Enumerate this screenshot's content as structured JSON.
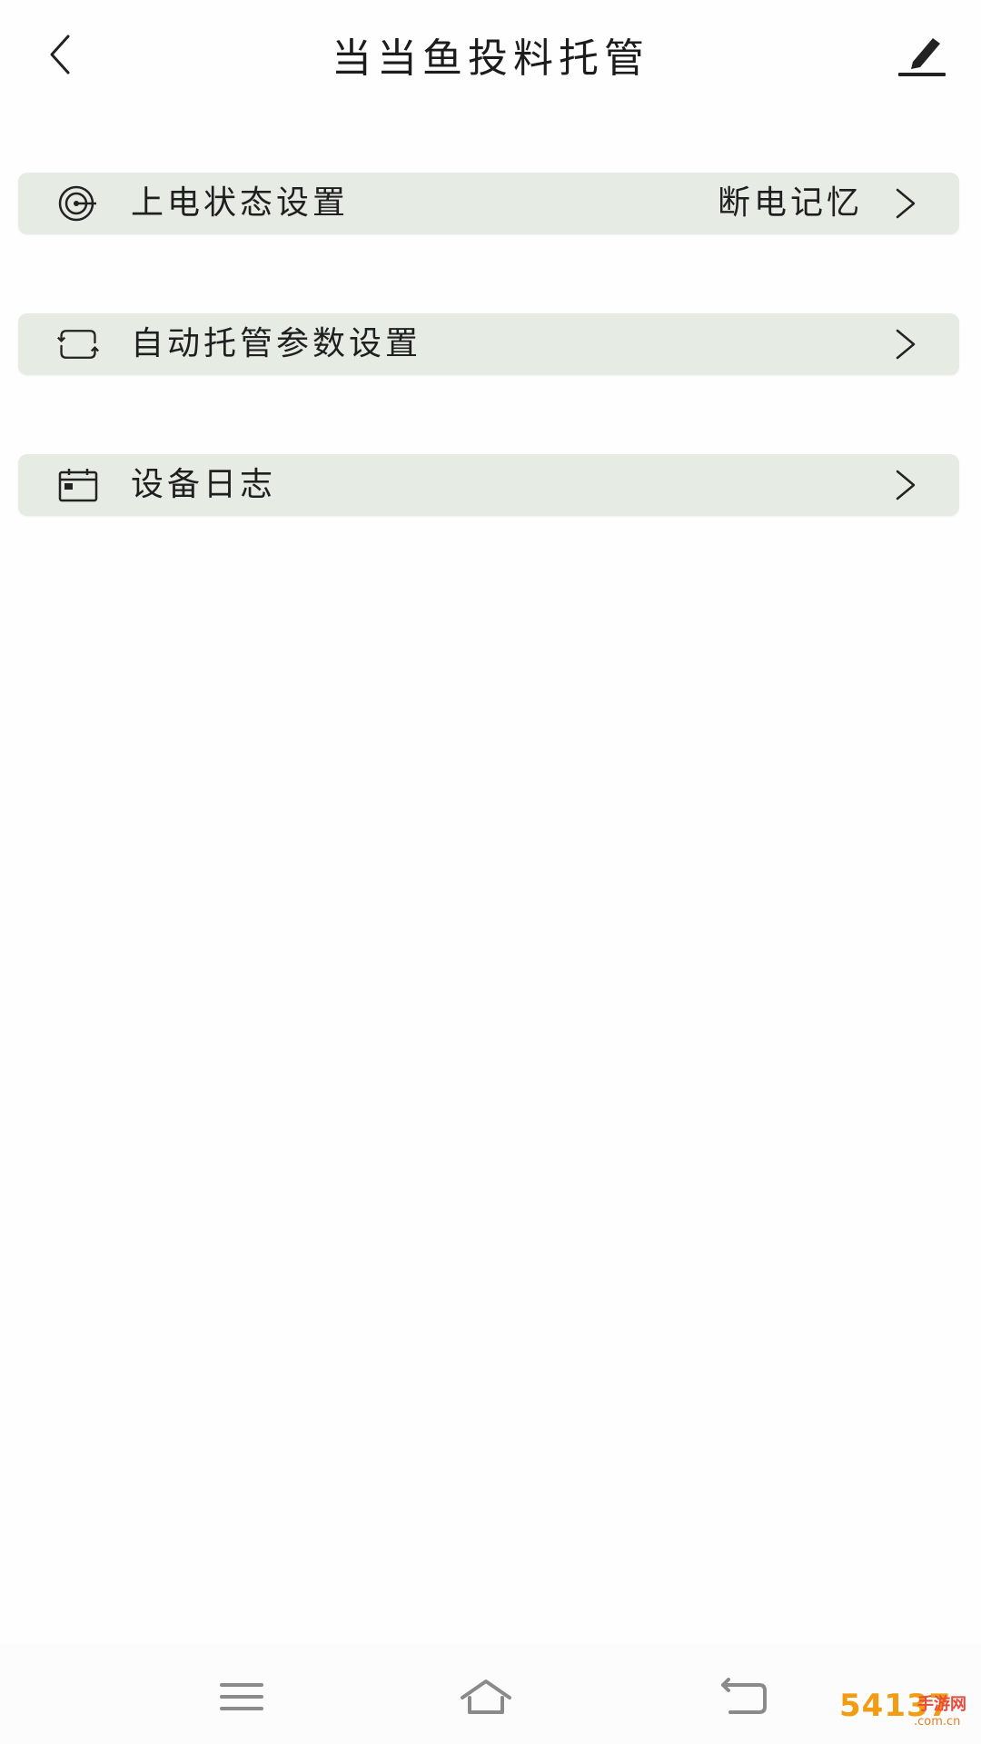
{
  "header": {
    "title": "当当鱼投料托管"
  },
  "rows": [
    {
      "label": "上电状态设置",
      "value": "断电记忆",
      "icon": "power-state-icon"
    },
    {
      "label": "自动托管参数设置",
      "value": "",
      "icon": "loop-icon"
    },
    {
      "label": "设备日志",
      "value": "",
      "icon": "calendar-icon"
    }
  ],
  "navbar": {
    "menu_icon": "menu-icon",
    "home_icon": "home-icon",
    "back_icon": "back-icon"
  },
  "watermark": {
    "main": "54137",
    "sub": "手游网",
    "url": ".com.cn"
  },
  "colors": {
    "row_background": "#e6ebe4",
    "text": "#1f1f1f",
    "page_background": "#fefefe"
  }
}
